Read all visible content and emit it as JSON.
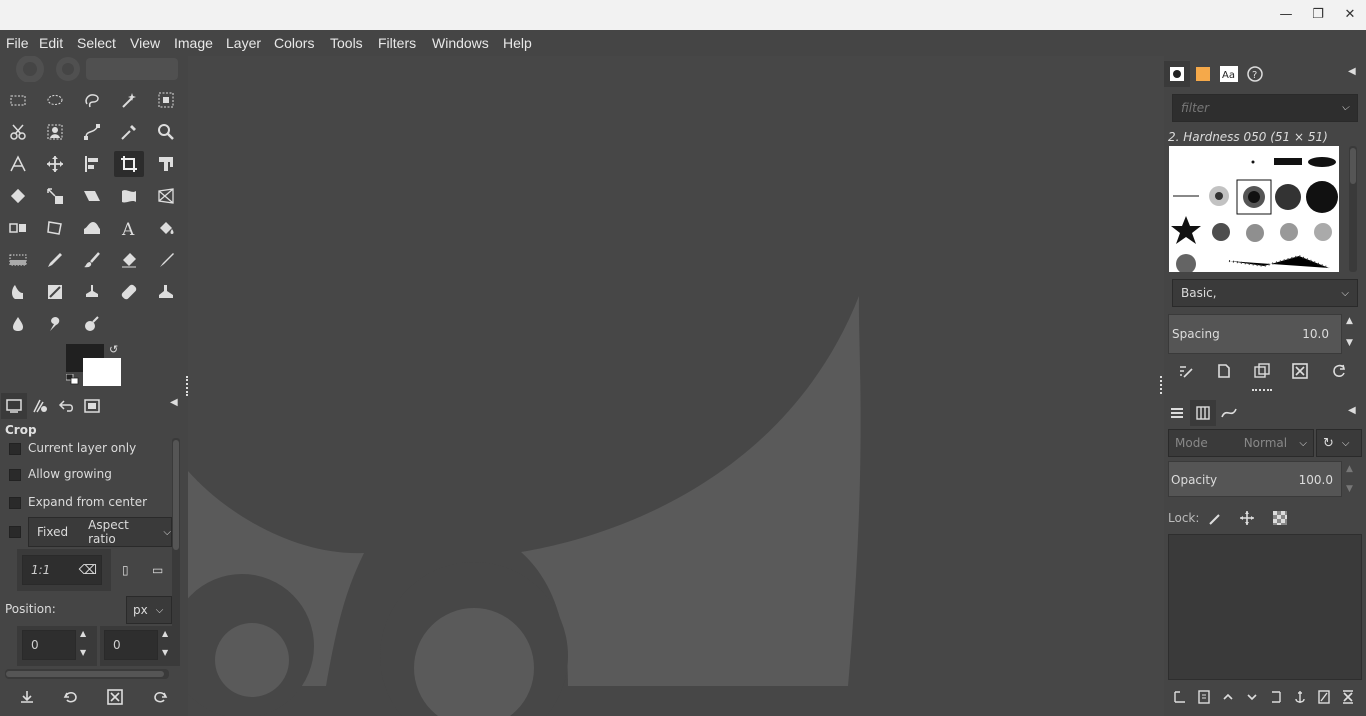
{
  "window": {
    "controls": [
      "minimize",
      "maximize",
      "close"
    ]
  },
  "menubar": {
    "items": [
      "File",
      "Edit",
      "Select",
      "View",
      "Image",
      "Layer",
      "Colors",
      "Tools",
      "Filters",
      "Windows",
      "Help"
    ]
  },
  "tool_options": {
    "title": "Crop",
    "current_layer_only": "Current layer only",
    "allow_growing": "Allow growing",
    "expand_from_center": "Expand from center",
    "fixed": "Fixed",
    "aspect_ratio": "Aspect ratio",
    "ratio_value": "1:1",
    "position_label": "Position:",
    "unit": "px",
    "pos_x": "0",
    "pos_y": "0"
  },
  "brushes": {
    "filter_placeholder": "filter",
    "selected_brush": "2. Hardness 050 (51 × 51)",
    "tag": "Basic,",
    "spacing_label": "Spacing",
    "spacing_value": "10.0"
  },
  "layers": {
    "mode_label": "Mode",
    "mode_value": "Normal",
    "opacity_label": "Opacity",
    "opacity_value": "100.0",
    "lock_label": "Lock:"
  },
  "colors": {
    "fg": "#202020",
    "bg": "#ffffff",
    "canvas": "#474747",
    "wilber": "#5a5a5a"
  }
}
